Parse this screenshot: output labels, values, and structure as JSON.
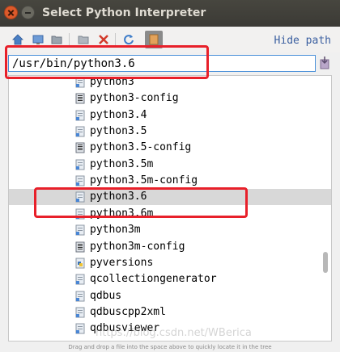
{
  "window": {
    "title": "Select Python Interpreter"
  },
  "toolbar": {
    "icons": [
      "home-icon",
      "desktop-icon",
      "folder-icon",
      "new-folder-icon",
      "delete-icon",
      "refresh-icon",
      "show-hidden-icon"
    ],
    "hide_path_label": "Hide path"
  },
  "path": {
    "value": "/usr/bin/python3.6"
  },
  "tree": {
    "items": [
      {
        "label": "python3",
        "icon": "link-file-icon"
      },
      {
        "label": "python3-config",
        "icon": "script-file-icon"
      },
      {
        "label": "python3.4",
        "icon": "link-file-icon"
      },
      {
        "label": "python3.5",
        "icon": "link-file-icon"
      },
      {
        "label": "python3.5-config",
        "icon": "script-file-icon"
      },
      {
        "label": "python3.5m",
        "icon": "link-file-icon"
      },
      {
        "label": "python3.5m-config",
        "icon": "link-file-icon"
      },
      {
        "label": "python3.6",
        "icon": "link-file-icon",
        "selected": true
      },
      {
        "label": "python3.6m",
        "icon": "link-file-icon"
      },
      {
        "label": "python3m",
        "icon": "link-file-icon"
      },
      {
        "label": "python3m-config",
        "icon": "script-file-icon"
      },
      {
        "label": "pyversions",
        "icon": "python-file-icon"
      },
      {
        "label": "qcollectiongenerator",
        "icon": "link-file-icon"
      },
      {
        "label": "qdbus",
        "icon": "link-file-icon"
      },
      {
        "label": "qdbuscpp2xml",
        "icon": "link-file-icon"
      },
      {
        "label": "qdbusviewer",
        "icon": "link-file-icon"
      }
    ]
  },
  "hint": "Drag and drop a file into the space above to quickly locate it in the tree",
  "watermark": "https://blog.csdn.net/WBerica",
  "colors": {
    "annotation": "#e8202a",
    "selection": "#d8d8d8",
    "link_blue": "#3b5fa0"
  }
}
